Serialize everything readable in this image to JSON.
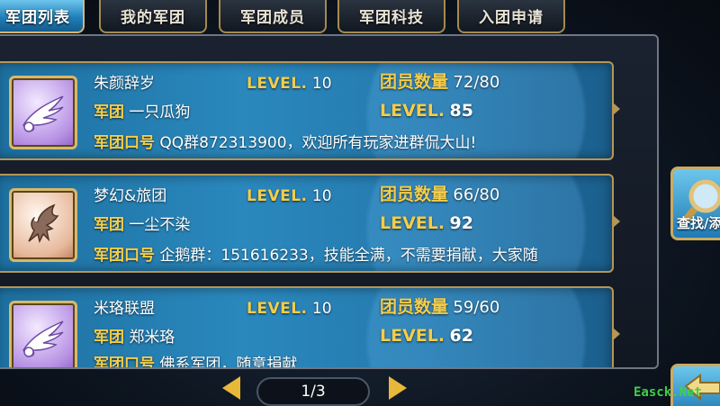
{
  "tabs": [
    {
      "label": "军团列表",
      "active": true
    },
    {
      "label": "我的军团",
      "active": false
    },
    {
      "label": "军团成员",
      "active": false
    },
    {
      "label": "军团科技",
      "active": false
    },
    {
      "label": "入团申请",
      "active": false
    }
  ],
  "labels": {
    "level": "LEVEL.",
    "member_count": "团员数量",
    "legion": "军团",
    "slogan": "军团口号"
  },
  "guilds": [
    {
      "leader": "朱颜辞岁",
      "leader_level": "10",
      "members": "72/80",
      "legion_name": "一只瓜狗",
      "legion_level": "85",
      "slogan": "QQ群872313900，欢迎所有玩家进群侃大山!",
      "emblem": "wing-emblem-icon"
    },
    {
      "leader": "梦幻&旅团",
      "leader_level": "10",
      "members": "66/80",
      "legion_name": "一尘不染",
      "legion_level": "92",
      "slogan": "企鹅群：151616233，技能全满，不需要捐献，大家随",
      "emblem": "griffin-emblem-icon"
    },
    {
      "leader": "米珞联盟",
      "leader_level": "10",
      "members": "59/60",
      "legion_name": "郑米珞",
      "legion_level": "62",
      "slogan": "佛系军团，随意捐献",
      "emblem": "wing-emblem-icon"
    }
  ],
  "pager": {
    "current": "1/3"
  },
  "side": {
    "search_label": "查找/添"
  },
  "watermark": "Easck.Net"
}
